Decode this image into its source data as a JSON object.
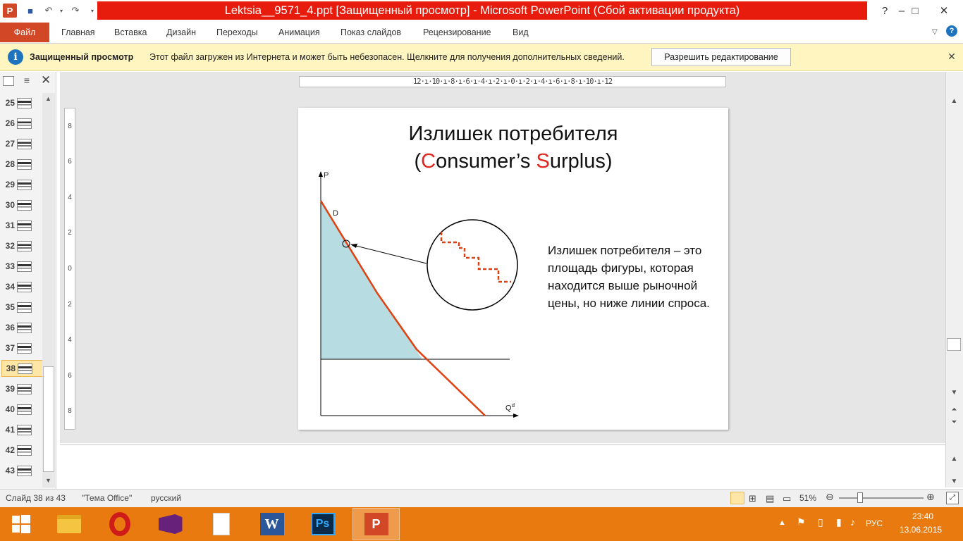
{
  "window": {
    "title": "Lektsia__9571_4.ppt [Защищенный просмотр] - Microsoft PowerPoint (Сбой активации продукта)",
    "help": "?",
    "minimize": "–",
    "maximize": "□",
    "close": "✕"
  },
  "ribbon": {
    "file": "Файл",
    "tabs": [
      "Главная",
      "Вставка",
      "Дизайн",
      "Переходы",
      "Анимация",
      "Показ слайдов",
      "Рецензирование",
      "Вид"
    ]
  },
  "protected": {
    "title": "Защищенный просмотр",
    "message": "Этот файл загружен из Интернета и может быть небезопасен. Щелкните для получения дополнительных сведений.",
    "button": "Разрешить редактирование"
  },
  "thumbnails": {
    "numbers": [
      "25",
      "26",
      "27",
      "28",
      "29",
      "30",
      "31",
      "32",
      "33",
      "34",
      "35",
      "36",
      "37",
      "38",
      "39",
      "40",
      "41",
      "42",
      "43"
    ],
    "selected": "38"
  },
  "ruler": {
    "h": "12·ı·10·ı·8·ı·6·ı·4·ı·2·ı·0·ı·2·ı·4·ı·6·ı·8·ı·10·ı·12",
    "v": [
      "8",
      "6",
      "4",
      "2",
      "0",
      "2",
      "4",
      "6",
      "8"
    ]
  },
  "slide": {
    "title_line1": "Излишек потребителя",
    "title_open": "(",
    "title_c": "C",
    "title_mid": "onsumer’s ",
    "title_s": "S",
    "title_end": "urplus)",
    "caption": "Излишек потребителя – это площадь фигуры, которая находится выше рыночной цены, но ниже линии спроса.",
    "axis_p": "P",
    "axis_q": "Q",
    "axis_q_sup": "d",
    "curve_label": "D"
  },
  "status": {
    "slide": "Слайд 38 из 43",
    "theme": "\"Тема Office\"",
    "lang": "русский",
    "zoom": "51%"
  },
  "tray": {
    "lang": "РУС",
    "time": "23:40",
    "date": "13.06.2015"
  },
  "colors": {
    "accent": "#e2261b",
    "fill": "#b7dde2",
    "taskbar": "#e87a10"
  }
}
